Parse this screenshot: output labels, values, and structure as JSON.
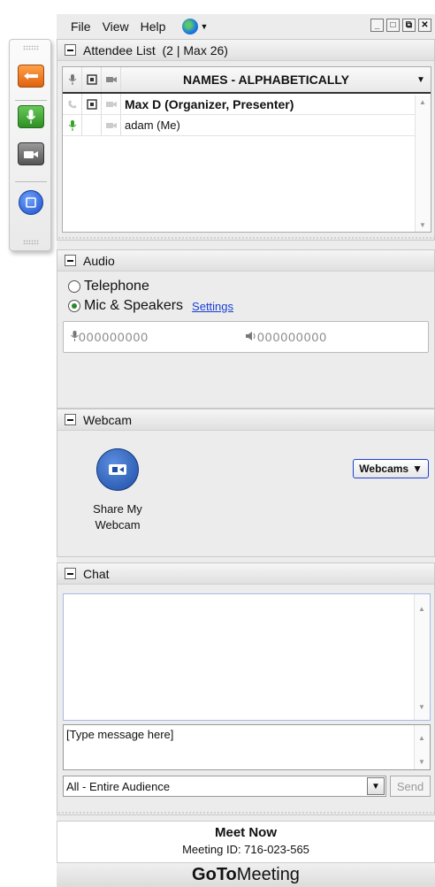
{
  "menu": {
    "file": "File",
    "view": "View",
    "help": "Help"
  },
  "attendee": {
    "title": "Attendee List",
    "count": "(2 | Max 26)",
    "column_names": "NAMES - ALPHABETICALLY",
    "rows": [
      {
        "name": "Max D (Organizer, Presenter)"
      },
      {
        "name": "adam (Me)"
      }
    ]
  },
  "audio": {
    "title": "Audio",
    "telephone": "Telephone",
    "mic": "Mic & Speakers",
    "settings": "Settings",
    "meter_left": "000000000",
    "meter_right": "000000000"
  },
  "webcam": {
    "title": "Webcam",
    "share_line1": "Share My",
    "share_line2": "Webcam",
    "webcams_button": "Webcams"
  },
  "chat": {
    "title": "Chat",
    "placeholder": "[Type message here]",
    "audience": "All - Entire Audience",
    "send": "Send"
  },
  "footer": {
    "meet_now": "Meet Now",
    "meeting_id": "Meeting ID: 716-023-565",
    "brand_bold": "GoTo",
    "brand_light": "Meeting"
  }
}
